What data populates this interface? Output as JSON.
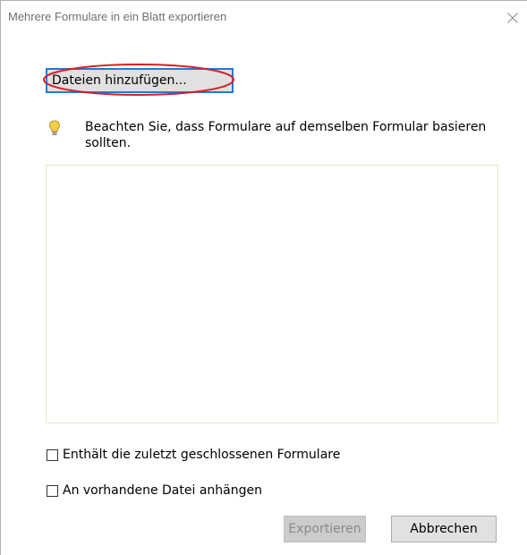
{
  "window": {
    "title": "Mehrere Formulare in ein Blatt exportieren"
  },
  "icons": {
    "close": "close-icon",
    "hint": "lightbulb-icon"
  },
  "colors": {
    "focus_border": "#1e7bd8",
    "annotation": "#d6202a",
    "list_border": "#e3e8c4"
  },
  "main": {
    "add_files_label": "Dateien hinzufügen...",
    "hint_text": "Beachten Sie, dass Formulare auf demselben Formular basieren sollten.",
    "files": []
  },
  "options": {
    "include_recent_label": "Enthält die zuletzt geschlossenen Formulare",
    "include_recent_checked": false,
    "append_label": "An vorhandene Datei anhängen",
    "append_checked": false
  },
  "footer": {
    "export_label": "Exportieren",
    "export_enabled": false,
    "cancel_label": "Abbrechen"
  }
}
